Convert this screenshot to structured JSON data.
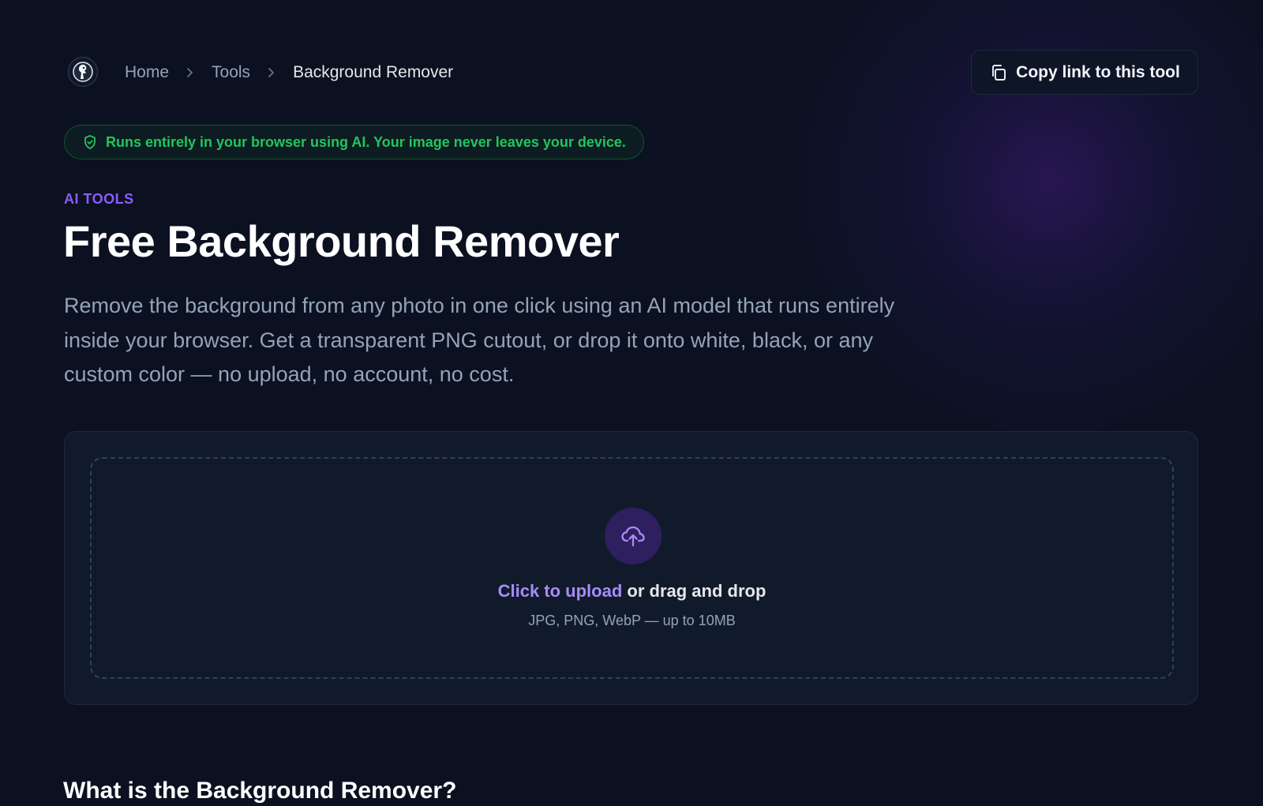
{
  "header": {
    "logo_icon": "character-logo-icon",
    "breadcrumb": {
      "home": "Home",
      "tools": "Tools",
      "current": "Background Remover"
    },
    "copy_button": {
      "label": "Copy link to this tool",
      "icon": "copy-icon"
    }
  },
  "privacy_badge": {
    "text": "Runs entirely in your browser using AI. Your image never leaves your device.",
    "icon": "shield-check-icon",
    "color": "#22c55e"
  },
  "hero": {
    "eyebrow": "AI TOOLS",
    "title": "Free Background Remover",
    "description": "Remove the background from any photo in one click using an AI model that runs entirely inside your browser. Get a transparent PNG cutout, or drop it onto white, black, or any custom color — no upload, no account, no cost."
  },
  "upload": {
    "icon": "cloud-upload-icon",
    "link_text": "Click to upload",
    "rest_text": " or drag and drop",
    "hint": "JPG, PNG, WebP — up to 10MB"
  },
  "section": {
    "title": "What is the Background Remover?"
  },
  "colors": {
    "background": "#0b1120",
    "accent": "#8b5cf6",
    "success": "#22c55e"
  }
}
